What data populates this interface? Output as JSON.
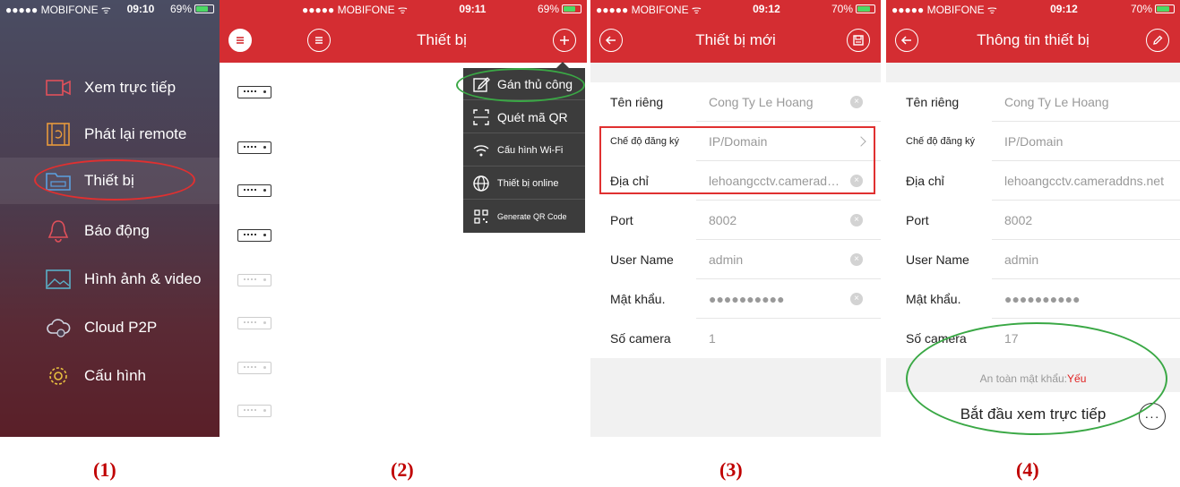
{
  "screens": [
    {
      "status": {
        "carrier": "●●●●● MOBIFONE ᯤ",
        "time": "09:10",
        "battery": "69%"
      },
      "menu": [
        {
          "label": "Xem trực tiếp",
          "icon": "camera-icon"
        },
        {
          "label": "Phát lại remote",
          "icon": "playback-icon"
        },
        {
          "label": "Thiết bị",
          "icon": "device-icon"
        },
        {
          "label": "Báo động",
          "icon": "bell-icon"
        },
        {
          "label": "Hình ảnh & video",
          "icon": "picture-icon"
        },
        {
          "label": "Cloud P2P",
          "icon": "cloud-icon"
        },
        {
          "label": "Cấu hình",
          "icon": "gear-icon"
        }
      ]
    },
    {
      "status": {
        "carrier": "●●●●● MOBIFONE ᯤ",
        "time": "09:11",
        "battery": "69%"
      },
      "title": "Thiết bị",
      "dropdown": [
        {
          "label": "Gán thủ công",
          "icon": "edit-icon"
        },
        {
          "label": "Quét mã QR",
          "icon": "scan-icon"
        },
        {
          "label": "Cấu hình Wi-Fi",
          "icon": "wifi-icon"
        },
        {
          "label": "Thiết bị online",
          "icon": "globe-icon"
        },
        {
          "label": "Generate QR Code",
          "icon": "qr-icon"
        }
      ]
    },
    {
      "status": {
        "carrier": "●●●●● MOBIFONE ᯤ",
        "time": "09:12",
        "battery": "70%"
      },
      "title": "Thiết bị mới",
      "rows": [
        {
          "label": "Tên riêng",
          "value": "Cong Ty Le Hoang"
        },
        {
          "label": "Chế độ đăng ký",
          "value": "IP/Domain"
        },
        {
          "label": "Địa chỉ",
          "value": "lehoangcctv.cameraddns.net"
        },
        {
          "label": "Port",
          "value": "8002"
        },
        {
          "label": "User Name",
          "value": "admin"
        },
        {
          "label": "Mật khẩu.",
          "value": "●●●●●●●●●●"
        },
        {
          "label": "Số camera",
          "value": "1"
        }
      ]
    },
    {
      "status": {
        "carrier": "●●●●● MOBIFONE ᯤ",
        "time": "09:12",
        "battery": "70%"
      },
      "title": "Thông tin thiết bị",
      "rows": [
        {
          "label": "Tên riêng",
          "value": "Cong Ty Le Hoang"
        },
        {
          "label": "Chế độ đăng ký",
          "value": "IP/Domain"
        },
        {
          "label": "Địa chỉ",
          "value": "lehoangcctv.cameraddns.net"
        },
        {
          "label": "Port",
          "value": "8002"
        },
        {
          "label": "User Name",
          "value": "admin"
        },
        {
          "label": "Mật khẩu.",
          "value": "●●●●●●●●●●"
        },
        {
          "label": "Số camera",
          "value": "17"
        }
      ],
      "password_strength_label": "An toàn mật khẩu:",
      "password_strength_value": "Yếu",
      "start_live_label": "Bắt đầu xem trực tiếp",
      "more_label": "···"
    }
  ],
  "captions": [
    "(1)",
    "(2)",
    "(3)",
    "(4)"
  ],
  "clear_glyph": "×",
  "colors": {
    "brand_red": "#d42d32",
    "highlight_green": "#3aa845",
    "highlight_red": "#e03030",
    "weak_red": "#e02020"
  }
}
